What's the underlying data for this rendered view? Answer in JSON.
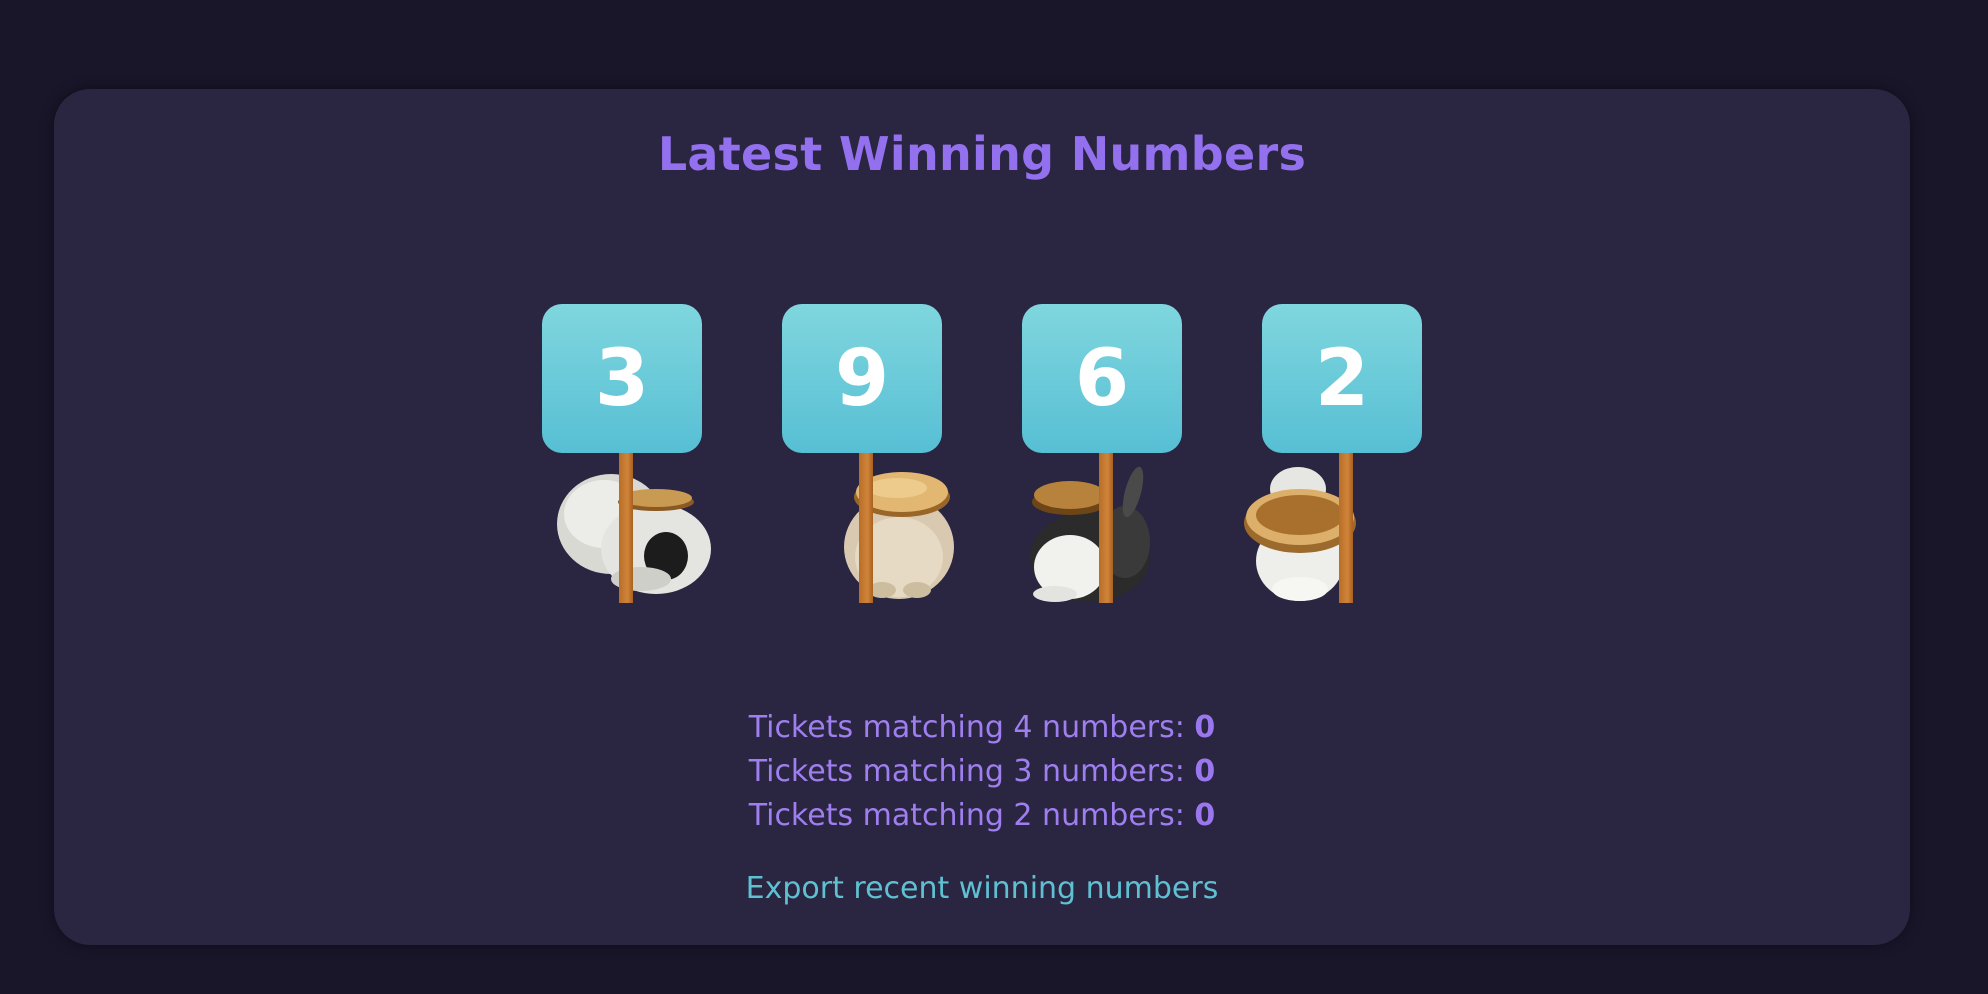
{
  "heading": "Latest Winning Numbers",
  "numbers": [
    {
      "value": "3",
      "icon": "rabbit-with-pancake-icon"
    },
    {
      "value": "9",
      "icon": "rabbit-with-pancake-icon"
    },
    {
      "value": "6",
      "icon": "rabbit-with-pancake-icon"
    },
    {
      "value": "2",
      "icon": "rabbit-with-pancake-icon"
    }
  ],
  "matches": [
    {
      "label": "Tickets matching 4 numbers:",
      "count": "0"
    },
    {
      "label": "Tickets matching 3 numbers:",
      "count": "0"
    },
    {
      "label": "Tickets matching 2 numbers:",
      "count": "0"
    }
  ],
  "export_link": "Export recent winning numbers",
  "colors": {
    "background": "#19162a",
    "card": "#2a2540",
    "accent_purple": "#9370ee",
    "accent_teal": "#5fc0d2",
    "sign_top": "#7fd6de",
    "sign_bottom": "#57bfd4",
    "stick": "#c27832"
  }
}
